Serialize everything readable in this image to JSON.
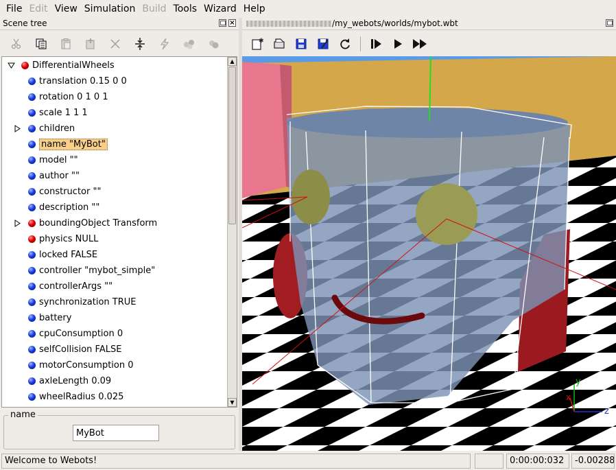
{
  "menu": {
    "items": [
      {
        "label": "File",
        "disabled": false
      },
      {
        "label": "Edit",
        "disabled": true
      },
      {
        "label": "View",
        "disabled": false
      },
      {
        "label": "Simulation",
        "disabled": false
      },
      {
        "label": "Build",
        "disabled": true
      },
      {
        "label": "Tools",
        "disabled": false
      },
      {
        "label": "Wizard",
        "disabled": false
      },
      {
        "label": "Help",
        "disabled": false
      }
    ]
  },
  "scene_tree": {
    "title": "Scene tree",
    "toolbar": [
      "cut-icon",
      "copy-icon",
      "paste-icon",
      "paste-after-icon",
      "delete-icon",
      "reset-icon",
      "transform-icon",
      "export-icon",
      "import-icon"
    ],
    "nodes": [
      {
        "label": "DifferentialWheels",
        "ball": "red",
        "expander": "open",
        "level": 0,
        "selected": false
      },
      {
        "label": "translation 0.15 0 0",
        "ball": "blue",
        "expander": "",
        "level": 1,
        "selected": false
      },
      {
        "label": "rotation 0 1 0 1",
        "ball": "blue",
        "expander": "",
        "level": 1,
        "selected": false
      },
      {
        "label": "scale 1 1 1",
        "ball": "blue",
        "expander": "",
        "level": 1,
        "selected": false
      },
      {
        "label": "children",
        "ball": "blue",
        "expander": "closed",
        "level": 1,
        "selected": false
      },
      {
        "label": "name \"MyBot\"",
        "ball": "blue",
        "expander": "",
        "level": 1,
        "selected": true
      },
      {
        "label": "model \"\"",
        "ball": "blue",
        "expander": "",
        "level": 1,
        "selected": false
      },
      {
        "label": "author \"\"",
        "ball": "blue",
        "expander": "",
        "level": 1,
        "selected": false
      },
      {
        "label": "constructor \"\"",
        "ball": "blue",
        "expander": "",
        "level": 1,
        "selected": false
      },
      {
        "label": "description \"\"",
        "ball": "blue",
        "expander": "",
        "level": 1,
        "selected": false
      },
      {
        "label": "boundingObject Transform",
        "ball": "red",
        "expander": "closed",
        "level": 1,
        "selected": false
      },
      {
        "label": "physics NULL",
        "ball": "red",
        "expander": "",
        "level": 1,
        "selected": false
      },
      {
        "label": "locked FALSE",
        "ball": "blue",
        "expander": "",
        "level": 1,
        "selected": false
      },
      {
        "label": "controller \"mybot_simple\"",
        "ball": "blue",
        "expander": "",
        "level": 1,
        "selected": false
      },
      {
        "label": "controllerArgs \"\"",
        "ball": "blue",
        "expander": "",
        "level": 1,
        "selected": false
      },
      {
        "label": "synchronization TRUE",
        "ball": "blue",
        "expander": "",
        "level": 1,
        "selected": false
      },
      {
        "label": "battery",
        "ball": "blue",
        "expander": "",
        "level": 1,
        "selected": false
      },
      {
        "label": "cpuConsumption 0",
        "ball": "blue",
        "expander": "",
        "level": 1,
        "selected": false
      },
      {
        "label": "selfCollision FALSE",
        "ball": "blue",
        "expander": "",
        "level": 1,
        "selected": false
      },
      {
        "label": "motorConsumption 0",
        "ball": "blue",
        "expander": "",
        "level": 1,
        "selected": false
      },
      {
        "label": "axleLength 0.09",
        "ball": "blue",
        "expander": "",
        "level": 1,
        "selected": false
      },
      {
        "label": "wheelRadius 0.025",
        "ball": "blue",
        "expander": "",
        "level": 1,
        "selected": false
      }
    ],
    "field_editor": {
      "legend": "name",
      "value": "MyBot"
    }
  },
  "view3d": {
    "path": "/my_webots/worlds/mybot.wbt",
    "toolbar": [
      "new-world-icon",
      "open-world-icon",
      "save-world-icon",
      "save-as-icon",
      "revert-icon",
      "step-icon",
      "run-icon",
      "fast-icon"
    ],
    "axes": {
      "x": "x",
      "y": "y",
      "z": "z"
    }
  },
  "status": {
    "message": "Welcome to Webots!",
    "time": "0:00:00:032",
    "value": "-0.00288"
  }
}
